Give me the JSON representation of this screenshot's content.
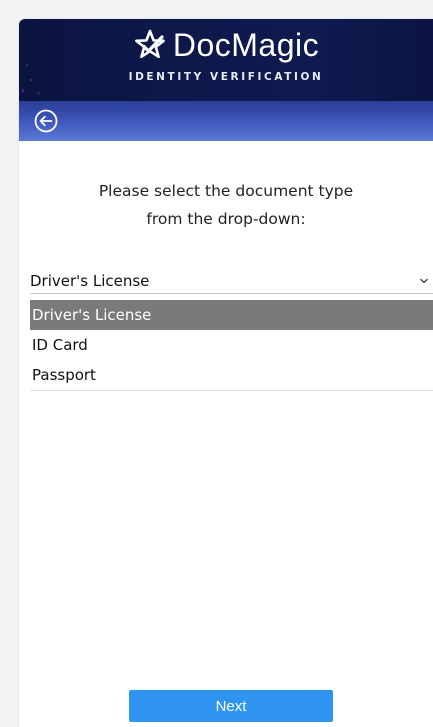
{
  "header": {
    "brand_name": "DocMagic",
    "subtitle": "IDENTITY VERIFICATION",
    "logo_icon": "star-check-icon",
    "back_icon": "arrow-left-circle-icon"
  },
  "main": {
    "instruction_line1": "Please select the document type",
    "instruction_line2": "from the drop-down:",
    "select": {
      "value": "Driver's License",
      "chevron_icon": "chevron-down-icon"
    },
    "options": [
      {
        "label": "Driver's License",
        "selected": true
      },
      {
        "label": "ID Card",
        "selected": false
      },
      {
        "label": "Passport",
        "selected": false
      }
    ]
  },
  "footer": {
    "next_label": "Next"
  },
  "colors": {
    "header_bg": "#0d1749",
    "nav_bg": "#3a54b8",
    "selected_option_bg": "#7a7a7a",
    "next_button_bg": "#2f95f0"
  }
}
